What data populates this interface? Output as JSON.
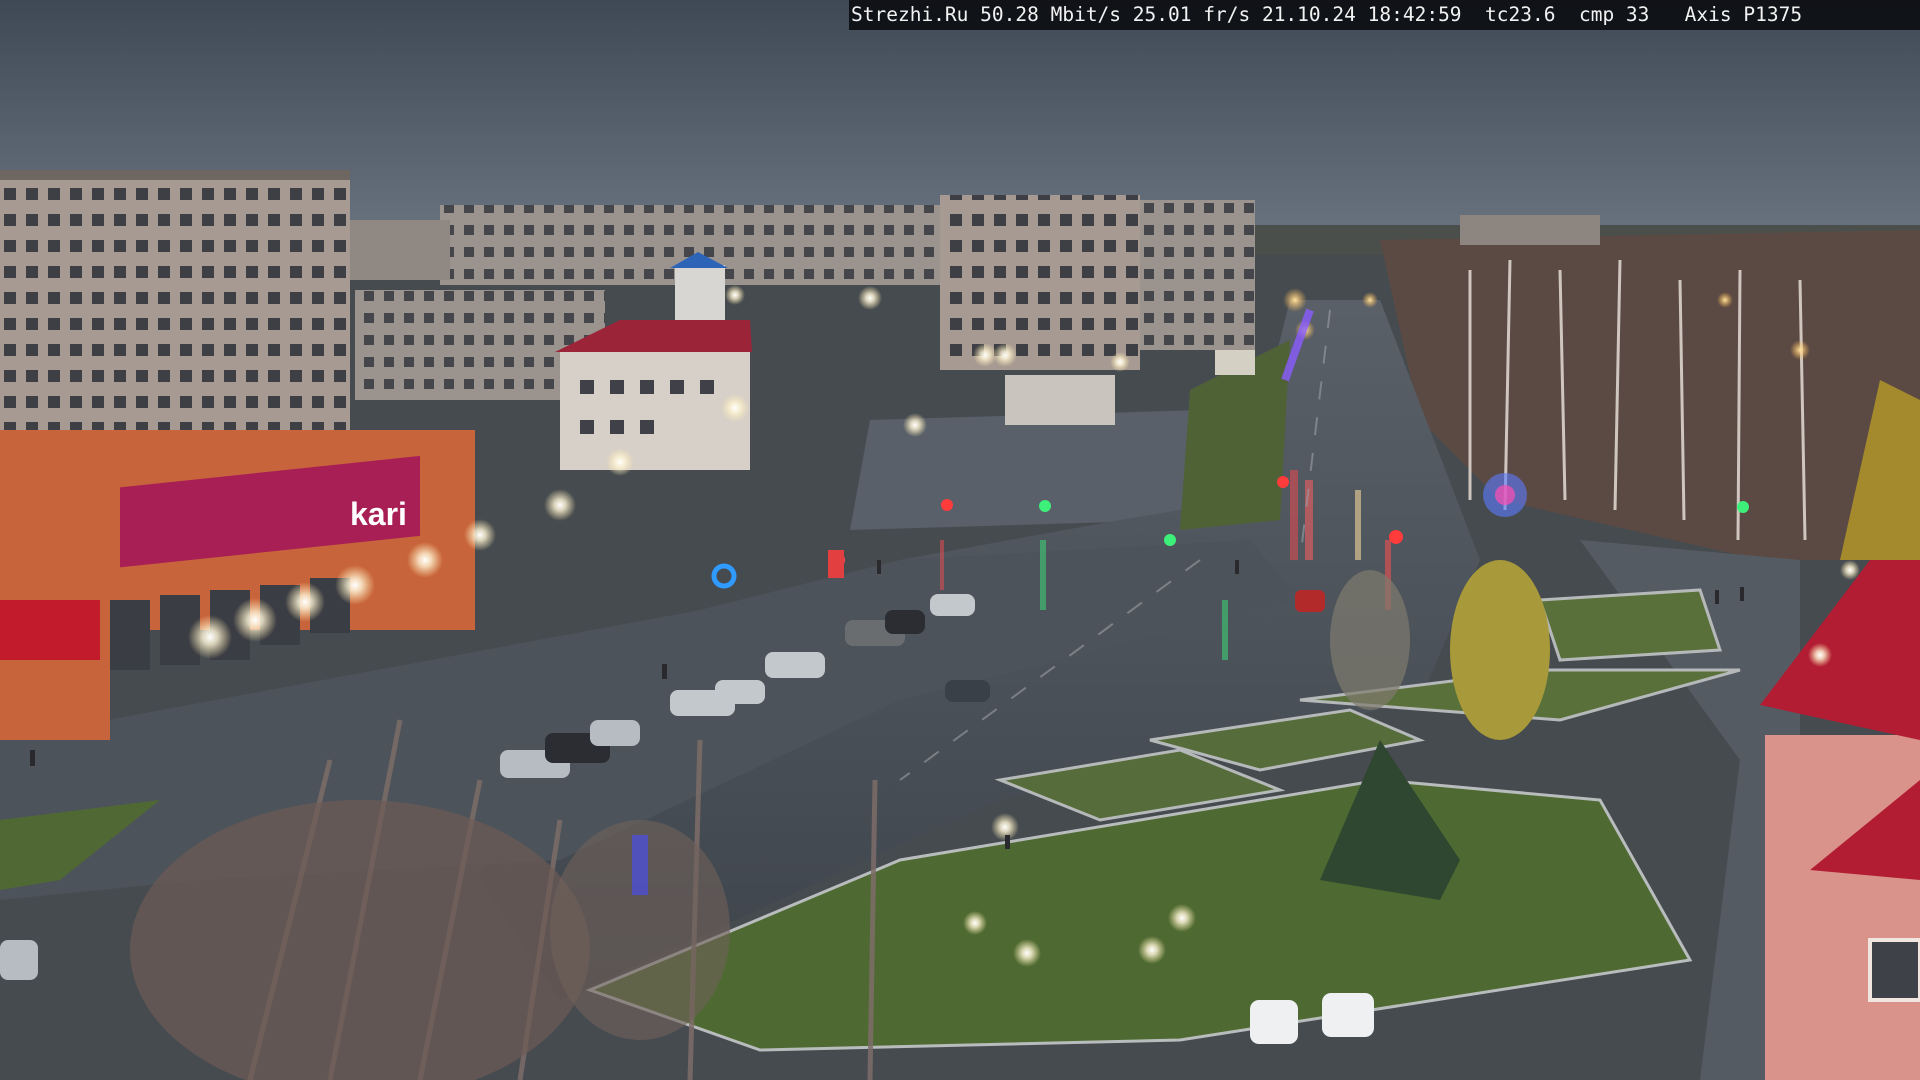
{
  "overlay": {
    "site": "Strezhi.Ru",
    "bitrate": "50.28 Mbit/s",
    "framerate": "25.01 fr/s",
    "date": "21.10.24",
    "time": "18:42:59",
    "tc": "tc23.6",
    "cmp": "cmp 33",
    "camera": "Axis P1375"
  },
  "signage": {
    "store_sign": "kari"
  },
  "colors": {
    "sky": "#4a5563",
    "road": "#4c5259",
    "grass": "#4f6a38",
    "roof_red": "#a8223a",
    "facade_orange": "#c9603a",
    "sign_magenta": "#b0205a"
  }
}
